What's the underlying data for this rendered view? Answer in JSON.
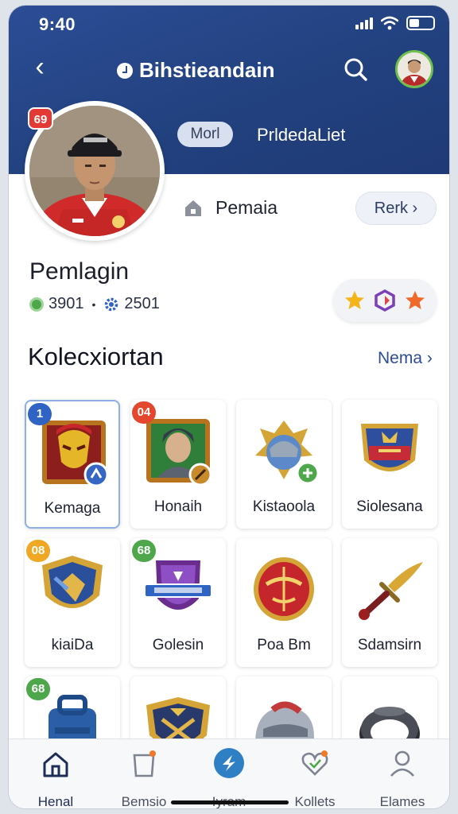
{
  "status": {
    "time": "9:40"
  },
  "header": {
    "title": "Bihstieandain",
    "mode_pill": "Morl",
    "tab_link": "PrldedaLiet"
  },
  "profile": {
    "avatar_badge": "69",
    "role_label": "Pemaia",
    "rank_button": "Rerk ›",
    "name": "Pemlagin",
    "coins": "3901",
    "separator": "•",
    "gears": "2501"
  },
  "collection": {
    "title": "Kolecxiortan",
    "see_all": "Nema ›",
    "items": [
      {
        "label": "Kemaga",
        "badge": "1",
        "badge_color": "#2f64c4",
        "art": "mask",
        "selected": true
      },
      {
        "label": "Honaih",
        "badge": "04",
        "badge_color": "#e3482e",
        "art": "warrior"
      },
      {
        "label": "Kistaoola",
        "badge": "",
        "art": "helmet"
      },
      {
        "label": "Siolesana",
        "badge": "",
        "art": "crest"
      },
      {
        "label": "kiaiDa",
        "badge": "08",
        "badge_color": "#f0a824",
        "art": "shield-blue"
      },
      {
        "label": "Golesin",
        "badge": "68",
        "badge_color": "#4ea84b",
        "art": "shield-purple"
      },
      {
        "label": "Poa Bm",
        "badge": "",
        "art": "shield-red"
      },
      {
        "label": "Sdamsirn",
        "badge": "",
        "art": "dagger"
      },
      {
        "label": "",
        "badge": "68",
        "badge_color": "#4ea84b",
        "art": "bag"
      },
      {
        "label": "",
        "badge": "",
        "art": "crest-dark"
      },
      {
        "label": "",
        "badge": "",
        "art": "helmet-silver"
      },
      {
        "label": "",
        "badge": "",
        "art": "ring"
      }
    ]
  },
  "bottom_nav": [
    {
      "label": "Henal",
      "icon": "home-icon",
      "active": true
    },
    {
      "label": "Bemsio",
      "icon": "bag-icon"
    },
    {
      "label": "Iyram",
      "icon": "compass-icon"
    },
    {
      "label": "Kollets",
      "icon": "heart-icon"
    },
    {
      "label": "Elames",
      "icon": "profile-icon"
    }
  ],
  "colors": {
    "primary": "#2c4d96",
    "accent_red": "#e33a36",
    "green": "#4ea84b"
  }
}
